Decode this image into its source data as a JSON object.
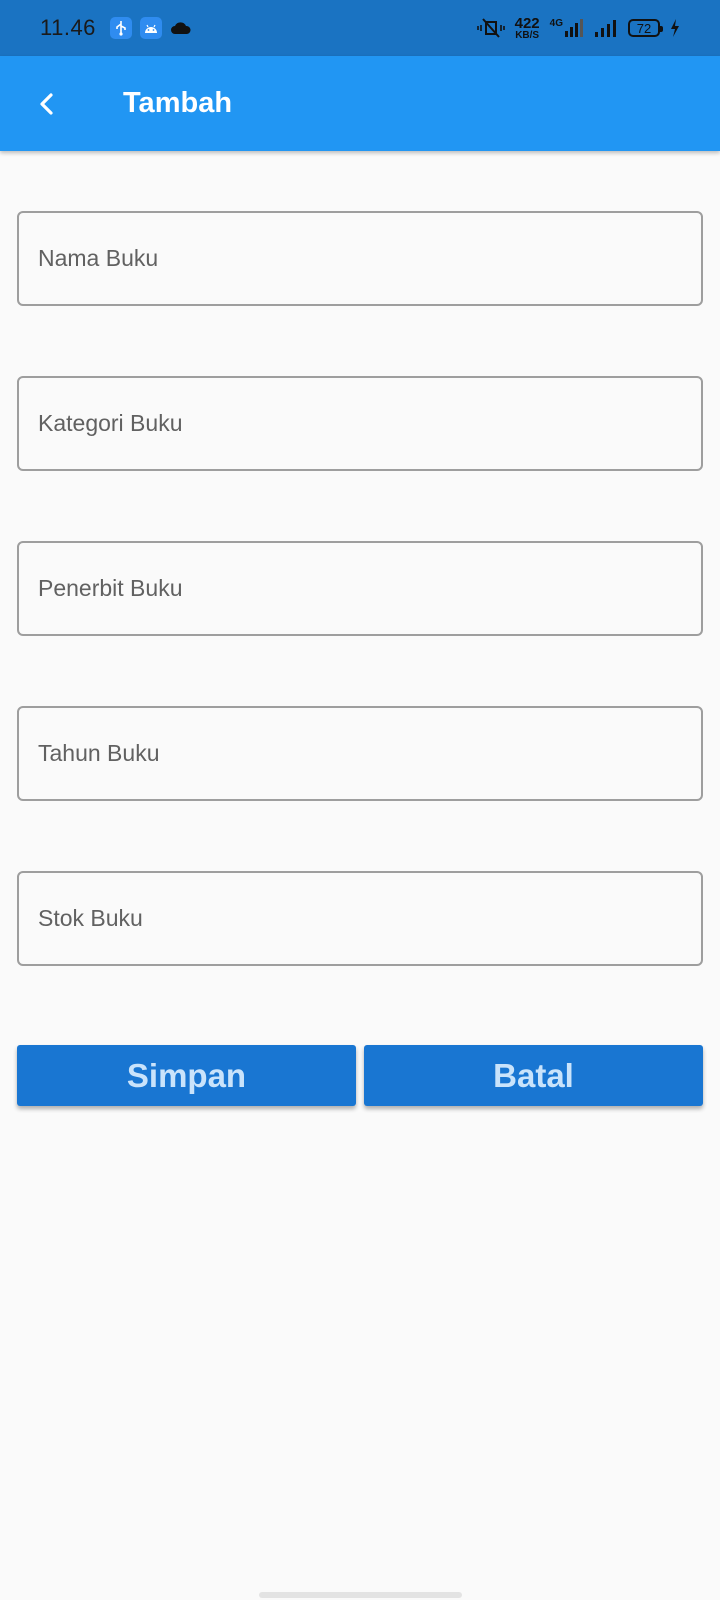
{
  "status_bar": {
    "time": "11.46",
    "net_speed_value": "422",
    "net_speed_unit": "KB/S",
    "network_type": "4G",
    "battery_level": "72"
  },
  "app_bar": {
    "title": "Tambah"
  },
  "form": {
    "fields": [
      {
        "placeholder": "Nama Buku",
        "value": ""
      },
      {
        "placeholder": "Kategori Buku",
        "value": ""
      },
      {
        "placeholder": "Penerbit Buku",
        "value": ""
      },
      {
        "placeholder": "Tahun Buku",
        "value": ""
      },
      {
        "placeholder": "Stok Buku",
        "value": ""
      }
    ]
  },
  "actions": {
    "save_label": "Simpan",
    "cancel_label": "Batal"
  },
  "colors": {
    "status_bar": "#1a73c2",
    "app_bar": "#2196f3",
    "button": "#1976d2",
    "button_text": "#c9e3fb",
    "background": "#fafafa"
  }
}
